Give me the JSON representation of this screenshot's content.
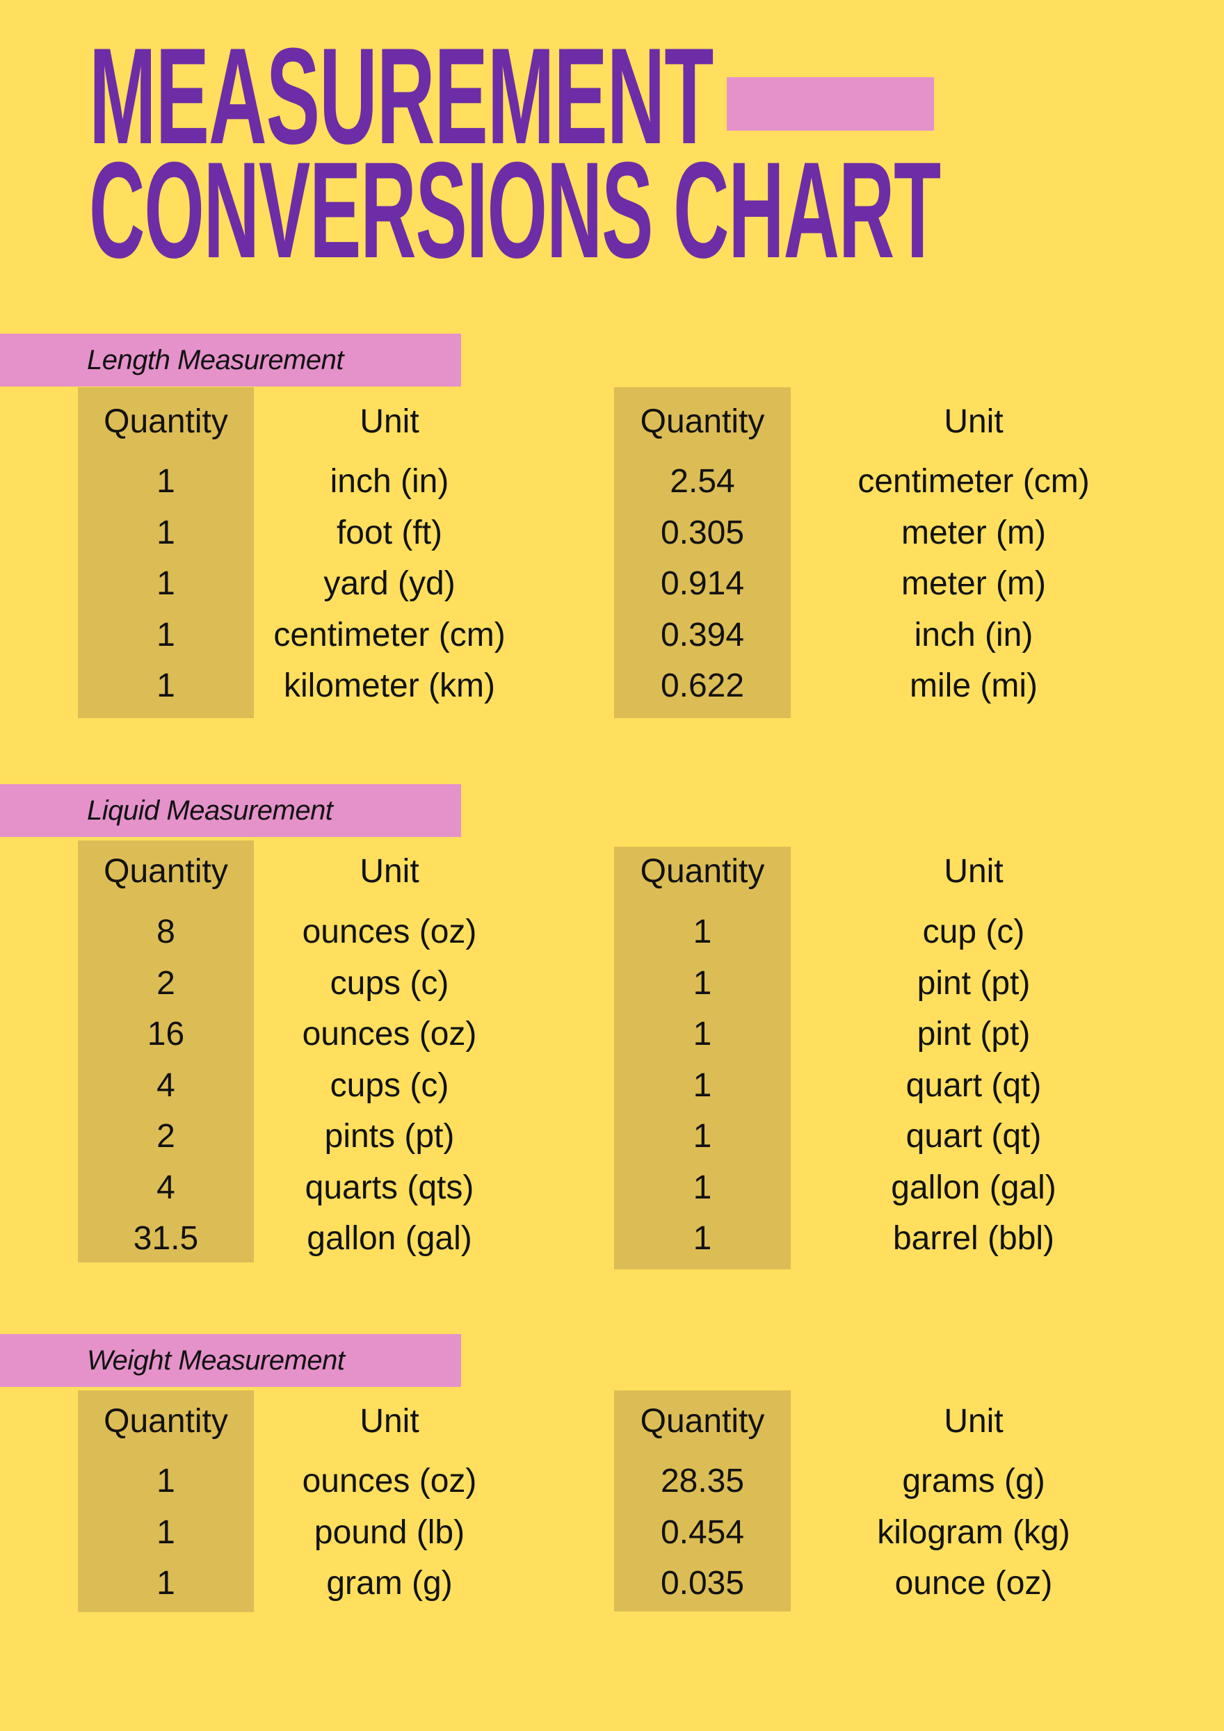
{
  "title": {
    "line1": "MEASUREMENT",
    "line2": "CONVERSIONS CHART"
  },
  "colors": {
    "background": "#FFDF5D",
    "title": "#6D2DA6",
    "accent_pink": "#E592CB",
    "quantity_column": "#DCBD55",
    "text": "#111111"
  },
  "headers": {
    "quantity": "Quantity",
    "unit": "Unit"
  },
  "sections": [
    {
      "label": "Length Measurement",
      "left": {
        "quantities": [
          "1",
          "1",
          "1",
          "1",
          "1"
        ],
        "units": [
          "inch (in)",
          "foot (ft)",
          "yard (yd)",
          "centimeter (cm)",
          "kilometer (km)"
        ]
      },
      "right": {
        "quantities": [
          "2.54",
          "0.305",
          "0.914",
          "0.394",
          "0.622"
        ],
        "units": [
          "centimeter (cm)",
          "meter (m)",
          "meter (m)",
          "inch (in)",
          "mile (mi)"
        ]
      }
    },
    {
      "label": "Liquid Measurement",
      "left": {
        "quantities": [
          "8",
          "2",
          "16",
          "4",
          "2",
          "4",
          "31.5"
        ],
        "units": [
          "ounces (oz)",
          "cups (c)",
          "ounces (oz)",
          "cups (c)",
          "pints (pt)",
          "quarts (qts)",
          "gallon (gal)"
        ]
      },
      "right": {
        "quantities": [
          "1",
          "1",
          "1",
          "1",
          "1",
          "1",
          "1"
        ],
        "units": [
          "cup (c)",
          "pint (pt)",
          "pint (pt)",
          "quart (qt)",
          "quart (qt)",
          "gallon (gal)",
          "barrel (bbl)"
        ]
      }
    },
    {
      "label": "Weight Measurement",
      "left": {
        "quantities": [
          "1",
          "1",
          "1"
        ],
        "units": [
          "ounces (oz)",
          "pound (lb)",
          "gram (g)"
        ]
      },
      "right": {
        "quantities": [
          "28.35",
          "0.454",
          "0.035"
        ],
        "units": [
          "grams (g)",
          "kilogram (kg)",
          "ounce (oz)"
        ]
      }
    }
  ]
}
